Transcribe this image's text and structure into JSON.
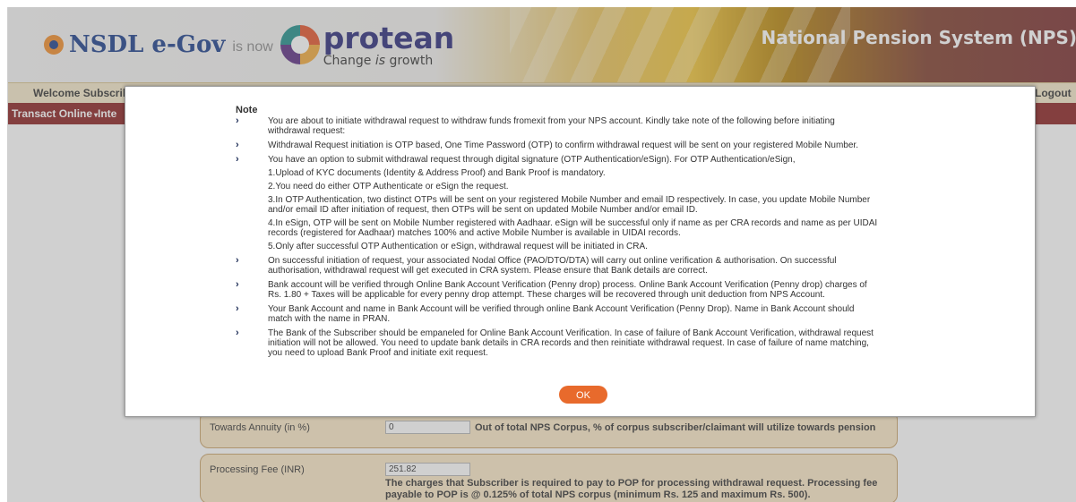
{
  "header": {
    "nsdl_logo": "NSDL e-Gov",
    "is_now": "is now",
    "protean_logo": "protean",
    "tagline_pre": "Change ",
    "tagline_em": "is",
    "tagline_post": " growth",
    "title": "National Pension System (NPS)"
  },
  "welcome_bar": {
    "welcome": "Welcome Subscribe",
    "logout": "Logout"
  },
  "menu": {
    "items": [
      "Transact Online",
      "Inte"
    ]
  },
  "form": {
    "annuity_label": "Towards Annuity (in %)",
    "annuity_value": "0",
    "annuity_note": "Out of total NPS Corpus, % of corpus subscriber/claimant will utilize towards pension",
    "fee_label": "Processing Fee (INR)",
    "fee_value": "251.82",
    "fee_note_1": "The charges that Subscriber is required to pay to POP for processing withdrawal request. Processing fee",
    "fee_note_2": "payable to POP is @ 0.125% of total NPS corpus (minimum Rs. 125 and maximum Rs. 500)."
  },
  "modal": {
    "title": "Note",
    "items": [
      {
        "bullet": true,
        "lines": [
          "You are about to initiate withdrawal request to withdraw funds fromexit from your NPS account. Kindly take note of the following before initiating",
          "withdrawal request:"
        ]
      },
      {
        "bullet": true,
        "lines": [
          "Withdrawal Request initiation is OTP based, One Time Password (OTP) to confirm withdrawal request will be sent on your registered Mobile Number."
        ]
      },
      {
        "bullet": true,
        "lines": [
          "You have an option to submit withdrawal request through digital signature (OTP Authentication/eSign). For OTP Authentication/eSign,"
        ]
      },
      {
        "bullet": false,
        "lines": [
          "1.Upload of KYC documents (Identity & Address Proof) and Bank Proof is mandatory."
        ]
      },
      {
        "bullet": false,
        "lines": [
          "2.You need do either OTP Authenticate or eSign the request."
        ]
      },
      {
        "bullet": false,
        "lines": [
          "3.In OTP Authentication, two distinct OTPs will be sent on your registered Mobile Number and email ID respectively. In case, you update Mobile Number",
          "and/or email ID after initiation of request, then OTPs will be sent on updated Mobile Number and/or email ID."
        ]
      },
      {
        "bullet": false,
        "lines": [
          "4.In eSign, OTP will be sent on Mobile Number registered with Aadhaar. eSign will be successful only if name as per CRA records and name as per UIDAI",
          "records (registered for Aadhaar) matches 100% and active Mobile Number is available in UIDAI records."
        ]
      },
      {
        "bullet": false,
        "lines": [
          "5.Only after successful OTP Authentication or eSign, withdrawal request will be initiated in CRA."
        ]
      },
      {
        "bullet": true,
        "lines": [
          "On successful initiation of request, your associated Nodal Office (PAO/DTO/DTA) will carry out online verification & authorisation. On successful",
          "authorisation, withdrawal request will get executed in CRA system. Please ensure that Bank details are correct."
        ]
      },
      {
        "bullet": true,
        "lines": [
          "Bank account will be verified through Online Bank Account Verification (Penny drop) process. Online Bank Account Verification (Penny drop) charges of",
          "Rs. 1.80 + Taxes will be applicable for every penny drop attempt. These charges will be recovered through unit deduction from NPS Account."
        ]
      },
      {
        "bullet": true,
        "lines": [
          "Your Bank Account and name in Bank Account will be verified through online Bank Account Verification (Penny Drop). Name in Bank Account should",
          "match with the name in PRAN."
        ]
      },
      {
        "bullet": true,
        "lines": [
          "The Bank of the Subscriber should be empaneled for Online Bank Account Verification. In case of failure of Bank Account Verification, withdrawal request",
          "initiation will not be allowed. You need to update bank details in CRA records and then reinitiate withdrawal request. In case of failure of name matching,",
          "you need to upload Bank Proof and initiate exit request."
        ]
      }
    ],
    "ok_label": "OK"
  },
  "colors": {
    "menu_bar": "#8b2121",
    "welcome_bar": "#f4e9c9",
    "form_box": "#fbe8c6",
    "ok_button": "#e86a2c",
    "bullet": "#1b2b55"
  }
}
